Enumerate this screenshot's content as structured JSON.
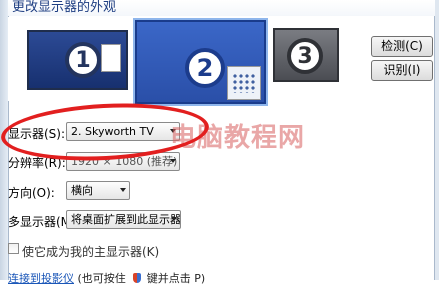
{
  "header": {
    "title": "更改显示器的外观"
  },
  "monitors": [
    {
      "number": "1"
    },
    {
      "number": "2"
    },
    {
      "number": "3"
    }
  ],
  "buttons": {
    "detect": "检测(C)",
    "identify": "识别(I)"
  },
  "settings": {
    "display": {
      "label": "显示器(S):",
      "value": "2. Skyworth TV"
    },
    "resolution": {
      "label": "分辨率(R):",
      "value": "1920 × 1080 (推荐)"
    },
    "orientation": {
      "label": "方向(O):",
      "value": "横向"
    },
    "multiple_displays": {
      "label": "多显示器(M):",
      "value": "将桌面扩展到此显示器"
    }
  },
  "main_display_checkbox": {
    "label": "使它成为我的主显示器(K)",
    "checked": false
  },
  "footer": {
    "link": "连接到投影仪",
    "text": "(也可按住",
    "text2": "键并点击 P)"
  },
  "watermark": "电脑教程网",
  "colors": {
    "highlight": "#e21f1f",
    "selected_monitor": "#3b67c8"
  }
}
